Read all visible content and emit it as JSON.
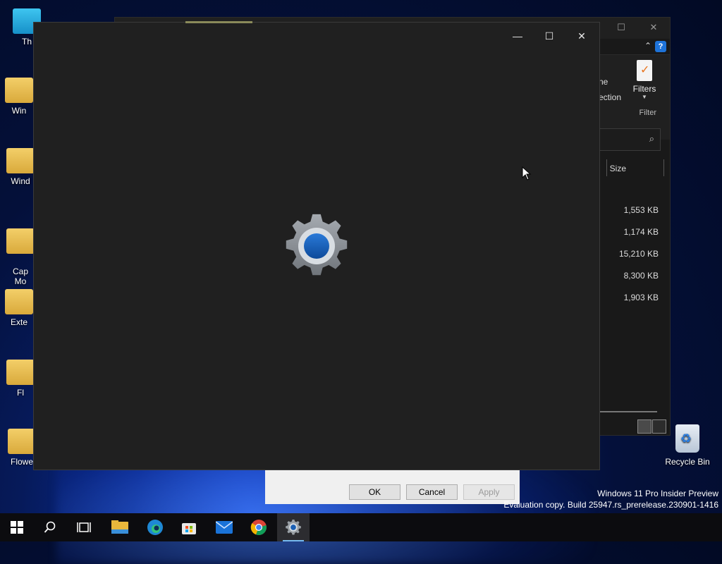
{
  "desktop": {
    "icons": [
      {
        "label": "Th",
        "icon": "this-pc-icon"
      },
      {
        "label": "Win",
        "icon": "folder-icon"
      },
      {
        "label": "Wind",
        "icon": "folder-icon"
      },
      {
        "label": "Cap\nMo",
        "icon": "capture-folder-icon"
      },
      {
        "label": "Exte",
        "icon": "folder-icon"
      },
      {
        "label": "Fl",
        "icon": "folder-icon"
      },
      {
        "label": "Flowe",
        "icon": "folder-icon"
      }
    ],
    "recycle_bin_label": "Recycle Bin",
    "watermark_line1": "Windows 11 Pro Insider Preview",
    "watermark_line2": "Evaluation copy. Build 25947.rs_prerelease.230901-1416"
  },
  "explorer": {
    "ribbon_partial_text1": "ne",
    "ribbon_partial_text2": "ection",
    "filters_label": "Filters",
    "filter_group_label": "Filter",
    "column_size_header": "Size",
    "sizes": [
      "1,553 KB",
      "1,174 KB",
      "15,210 KB",
      "8,300 KB",
      "1,903 KB"
    ],
    "help_label": "?"
  },
  "dialog": {
    "ok_label": "OK",
    "cancel_label": "Cancel",
    "apply_label": "Apply"
  },
  "settings_window": {
    "minimize_glyph": "—",
    "maximize_glyph": "☐",
    "close_glyph": "✕"
  },
  "colors": {
    "settings_bg": "#202020",
    "gear_gray": "#8e9399",
    "gear_blue": "#1a5fb4",
    "taskbar_accent": "#76b9ed"
  },
  "taskbar": {
    "items": [
      "start-icon",
      "search-icon",
      "task-view-icon",
      "file-explorer-icon",
      "edge-icon",
      "store-icon",
      "mail-icon",
      "chrome-icon",
      "settings-icon"
    ]
  }
}
